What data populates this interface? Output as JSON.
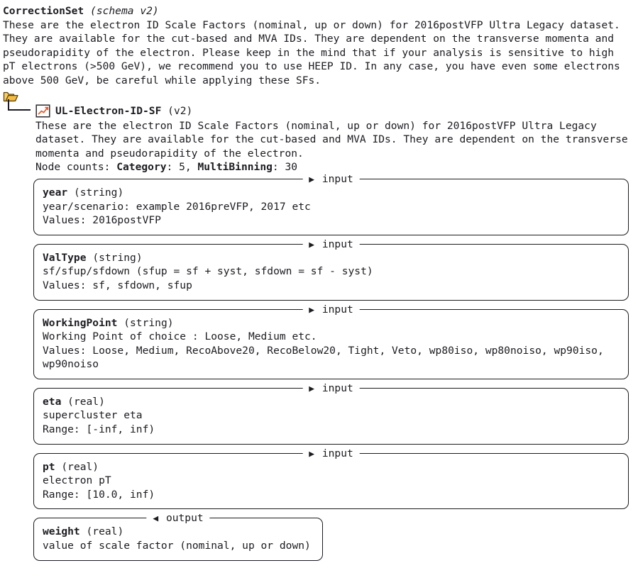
{
  "root": {
    "title_name": "CorrectionSet",
    "title_schema": "(schema v2)",
    "description": "These are the electron ID Scale Factors (nominal, up or down) for 2016postVFP Ultra Legacy dataset.\nThey are available for the cut-based and MVA IDs. They are dependent on the transverse momenta and\npseudorapidity of the electron. Please keep in the mind that if your analysis is sensitive to high\npT electrons (>500 GeV), we recommend you to use HEEP ID. In any case, you have even some electrons\nabove 500 GeV, be careful while applying these SFs.",
    "folder_icon": "folder-icon"
  },
  "node": {
    "icon": "chart-increasing-icon",
    "name": "UL-Electron-ID-SF",
    "version": "(v2)",
    "description": "These are the electron ID Scale Factors (nominal, up or down) for 2016postVFP Ultra Legacy\ndataset. They are available for the cut-based and MVA IDs. They are dependent on the transverse\nmomenta and pseudorapidity of the electron.",
    "counts_label": "Node counts: ",
    "counts": [
      {
        "label": "Category",
        "value": ": 5, "
      },
      {
        "label": "MultiBinning",
        "value": ": 30"
      }
    ]
  },
  "panels": [
    {
      "kind": "input",
      "legend_arrow": "▶",
      "legend_label": "input",
      "name": "year",
      "type": "(string)",
      "description": "year/scenario: example 2016preVFP, 2017 etc",
      "detail": "Values: 2016postVFP"
    },
    {
      "kind": "input",
      "legend_arrow": "▶",
      "legend_label": "input",
      "name": "ValType",
      "type": "(string)",
      "description": "sf/sfup/sfdown (sfup = sf + syst, sfdown = sf - syst)",
      "detail": "Values: sf, sfdown, sfup"
    },
    {
      "kind": "input",
      "legend_arrow": "▶",
      "legend_label": "input",
      "name": "WorkingPoint",
      "type": "(string)",
      "description": "Working Point of choice : Loose, Medium etc.",
      "detail": "Values: Loose, Medium, RecoAbove20, RecoBelow20, Tight, Veto, wp80iso, wp80noiso, wp90iso,\nwp90noiso"
    },
    {
      "kind": "input",
      "legend_arrow": "▶",
      "legend_label": "input",
      "name": "eta",
      "type": "(real)",
      "description": "supercluster eta",
      "detail": "Range: [-inf, inf)"
    },
    {
      "kind": "input",
      "legend_arrow": "▶",
      "legend_label": "input",
      "name": "pt",
      "type": "(real)",
      "description": "electron pT",
      "detail": "Range: [10.0, inf)"
    },
    {
      "kind": "output",
      "legend_arrow": "◀",
      "legend_label": "output",
      "name": "weight",
      "type": "(real)",
      "description": "value of scale factor (nominal, up or down)",
      "detail": ""
    }
  ],
  "colors": {
    "text": "#1c1c22",
    "folder": "#f5c24c",
    "folder_edge": "#b8860b",
    "chart_line": "#e8582a",
    "border": "#1c1c22",
    "background": "#ffffff"
  }
}
